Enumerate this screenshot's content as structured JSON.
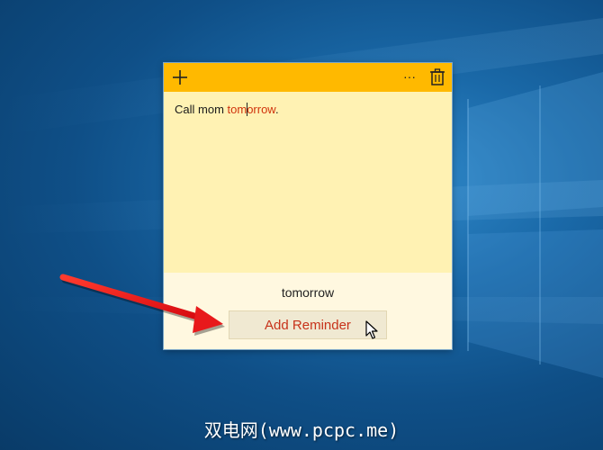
{
  "note": {
    "text_before": "Call mom ",
    "text_highlight_a": "tom",
    "text_highlight_b": "orrow",
    "text_after": ".",
    "suggestion": "tomorrow",
    "reminder_button_label": "Add Reminder"
  },
  "toolbar": {
    "add_icon": "plus-icon",
    "menu_icon": "ellipsis-icon",
    "delete_icon": "trash-icon",
    "menu_glyph": "···"
  },
  "watermark": {
    "text": "双电网(www.pcpc.me)"
  },
  "colors": {
    "header": "#ffb900",
    "body": "#fff2b3",
    "footer": "#fff8e0",
    "highlight": "#d0330c",
    "arrow": "#e8191b"
  }
}
